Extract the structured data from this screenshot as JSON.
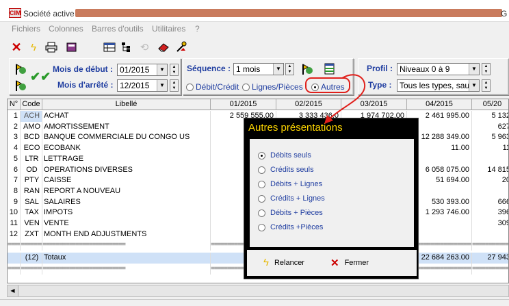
{
  "window": {
    "logo": "CIM",
    "title": "Société active",
    "title_right": "G"
  },
  "menu": [
    "Fichiers",
    "Colonnes",
    "Barres d'outils",
    "Utilitaires",
    "?"
  ],
  "toolbar": [
    "close-icon",
    "flash-icon",
    "print-icon",
    "book-icon",
    "table-icon",
    "tree-icon",
    "refresh-icon",
    "eraser-icon",
    "wizard-icon"
  ],
  "filters": {
    "start_label": "Mois de début :",
    "start_value": "01/2015",
    "end_label": "Mois d'arrêté :",
    "end_value": "12/2015",
    "sequence_label": "Séquence :",
    "sequence_value": "1 mois",
    "radio_debit_credit": "Débit/Crédit",
    "radio_lignes_pieces": "Lignes/Pièces",
    "radio_autres": "Autres",
    "profil_label": "Profil :",
    "profil_value": "Niveaux 0 à 9",
    "type_label": "Type :",
    "type_value": "Tous les types, sauf C"
  },
  "grid": {
    "headers": [
      "N°",
      "Code",
      "Libellé",
      "01/2015",
      "02/2015",
      "03/2015",
      "04/2015",
      "05/20"
    ],
    "rows": [
      {
        "n": "1",
        "code": "ACH",
        "label": "ACHAT",
        "m1": "2 559 555.00",
        "m2": "3 333 436.0",
        "m3": "1 974 702.00",
        "m4": "2 461 995.00",
        "m5": "5 132"
      },
      {
        "n": "2",
        "code": "AMO",
        "label": "AMORTISSEMENT",
        "m1": "",
        "m2": "",
        "m3": "",
        "m4": "",
        "m5": "627"
      },
      {
        "n": "3",
        "code": "BCD",
        "label": "BANQUE COMMERCIALE DU CONGO US",
        "m1": "11 65",
        "m2": "",
        "m3": "",
        "m4": "12 288 349.00",
        "m5": "5 963"
      },
      {
        "n": "4",
        "code": "ECO",
        "label": "ECOBANK",
        "m1": "",
        "m2": "",
        "m3": "",
        "m4": "11.00",
        "m5": "11"
      },
      {
        "n": "5",
        "code": "LTR",
        "label": "LETTRAGE",
        "m1": "",
        "m2": "",
        "m3": "",
        "m4": "",
        "m5": ""
      },
      {
        "n": "6",
        "code": "OD",
        "label": "OPERATIONS DIVERSES",
        "m1": "5 49",
        "m2": "",
        "m3": "",
        "m4": "6 058 075.00",
        "m5": "14 815"
      },
      {
        "n": "7",
        "code": "PTY",
        "label": "CAISSE",
        "m1": "4",
        "m2": "",
        "m3": "",
        "m4": "51 694.00",
        "m5": "20"
      },
      {
        "n": "8",
        "code": "RAN",
        "label": "REPORT A NOUVEAU",
        "m1": "42 30",
        "m2": "",
        "m3": "",
        "m4": "",
        "m5": ""
      },
      {
        "n": "9",
        "code": "SAL",
        "label": "SALAIRES",
        "m1": "54",
        "m2": "",
        "m3": "",
        "m4": "530 393.00",
        "m5": "666"
      },
      {
        "n": "10",
        "code": "TAX",
        "label": "IMPOTS",
        "m1": "1 84",
        "m2": "",
        "m3": "",
        "m4": "1 293 746.00",
        "m5": "396"
      },
      {
        "n": "11",
        "code": "VEN",
        "label": "VENTE",
        "m1": "13 26",
        "m2": "",
        "m3": "",
        "m4": "",
        "m5": "309"
      },
      {
        "n": "12",
        "code": "ZXT",
        "label": "MONTH END ADJUSTMENTS",
        "m1": "",
        "m2": "",
        "m3": "",
        "m4": "",
        "m5": ""
      }
    ],
    "separator": "=========================",
    "totals": {
      "n": "",
      "code": "(12)",
      "label": "Totaux",
      "m1": "77 71",
      "m2": "",
      "m3": "",
      "m4": "22 684 263.00",
      "m5": "27 943"
    }
  },
  "dialog": {
    "title": "Autres présentations",
    "options": [
      "Débits seuls",
      "Crédits seuls",
      "Débits + Lignes",
      "Crédits + Lignes",
      "Débits + Pièces",
      "Crédits +Pièces"
    ],
    "selected": 0,
    "relaunch_label": "Relancer",
    "close_label": "Fermer"
  },
  "colors": {
    "label_blue": "#1f3da0",
    "dialog_title": "#ffd700",
    "highlight": "#cfe1f7",
    "annotation_red": "#e0201b"
  }
}
